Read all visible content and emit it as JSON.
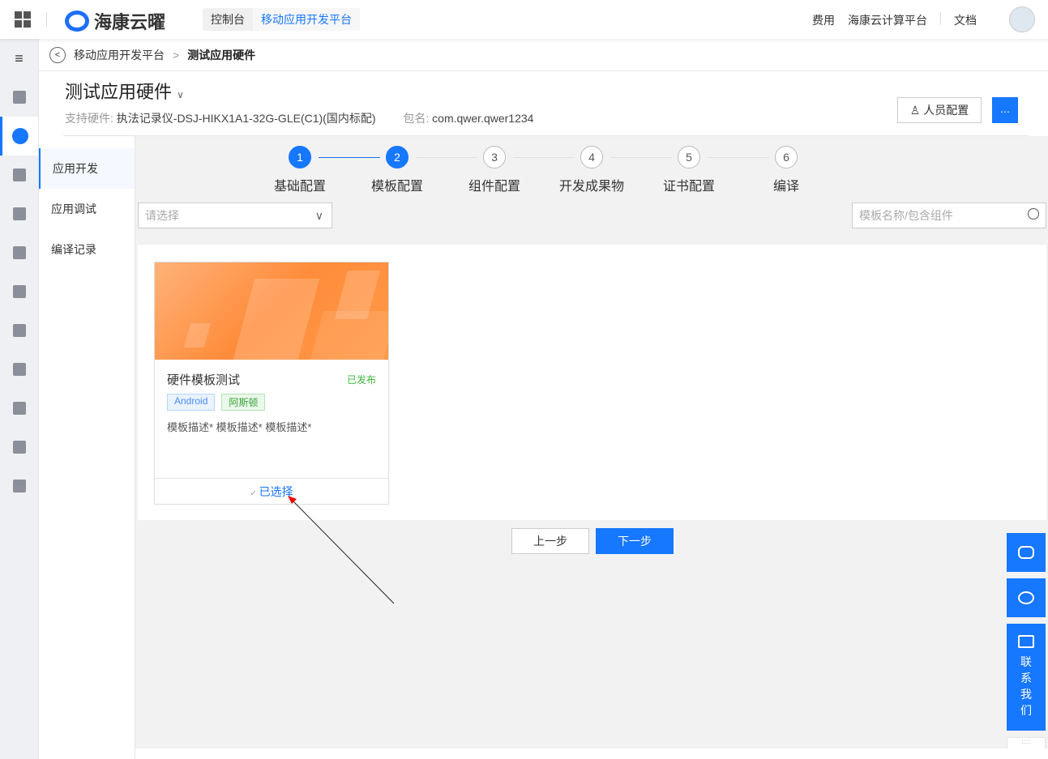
{
  "topbar": {
    "brand": "海康云曜",
    "crumbs": [
      "控制台",
      "移动应用开发平台"
    ],
    "links": [
      "费用",
      "海康云计算平台",
      "文档"
    ]
  },
  "breadcrumb": {
    "parent": "移动应用开发平台",
    "current": "测试应用硬件"
  },
  "header": {
    "title": "测试应用硬件",
    "hardware_label": "支持硬件:",
    "hardware_value": "执法记录仪-DSJ-HIKX1A1-32G-GLE(C1)(国内标配)",
    "package_label": "包名:",
    "package_value": "com.qwer.qwer1234",
    "people_button": "人员配置",
    "more_button": "..."
  },
  "subnav": [
    "应用开发",
    "应用调试",
    "编译记录"
  ],
  "steps": [
    {
      "n": "1",
      "label": "基础配置"
    },
    {
      "n": "2",
      "label": "模板配置"
    },
    {
      "n": "3",
      "label": "组件配置"
    },
    {
      "n": "4",
      "label": "开发成果物"
    },
    {
      "n": "5",
      "label": "证书配置"
    },
    {
      "n": "6",
      "label": "编译"
    }
  ],
  "current_step": 2,
  "filter": {
    "select_placeholder": "请选择",
    "search_placeholder": "模板名称/包含组件"
  },
  "card": {
    "title": "硬件模板测试",
    "status": "已发布",
    "tags": [
      "Android",
      "阿斯顿"
    ],
    "description": "模板描述* 模板描述* 模板描述*",
    "selected_label": "已选择"
  },
  "actions": {
    "prev": "上一步",
    "next": "下一步"
  },
  "float": {
    "contact": [
      "联",
      "系",
      "我",
      "们"
    ]
  }
}
